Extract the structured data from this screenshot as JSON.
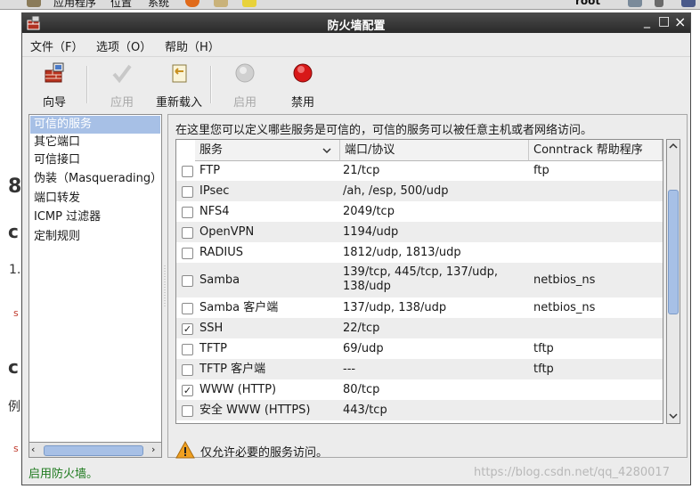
{
  "panel": {
    "menus": [
      "应用程序",
      "位置",
      "系统"
    ],
    "user": "root"
  },
  "background": {
    "fragments": [
      "8",
      "c",
      "1.",
      "s",
      "c",
      "例",
      "s"
    ]
  },
  "window": {
    "title": "防火墙配置",
    "controls": {
      "minimize": "_",
      "maximize": "□",
      "close": "×"
    },
    "menu": [
      "文件（F）",
      "选项（O）",
      "帮助（H）"
    ],
    "toolbar": [
      {
        "label": "向导",
        "enabled": true,
        "icon": "wizard-icon"
      },
      {
        "label": "应用",
        "enabled": false,
        "icon": "apply-check-icon"
      },
      {
        "label": "重新载入",
        "enabled": true,
        "icon": "reload-icon"
      },
      {
        "label": "启用",
        "enabled": false,
        "icon": "enable-grey-circle-icon"
      },
      {
        "label": "禁用",
        "enabled": true,
        "icon": "disable-red-circle-icon"
      }
    ],
    "sidebar": [
      {
        "label": "可信的服务",
        "selected": true
      },
      {
        "label": "其它端口",
        "selected": false
      },
      {
        "label": "可信接口",
        "selected": false
      },
      {
        "label": "伪装（Masquerading）",
        "selected": false
      },
      {
        "label": "端口转发",
        "selected": false
      },
      {
        "label": "ICMP 过滤器",
        "selected": false
      },
      {
        "label": "定制规则",
        "selected": false
      }
    ],
    "description": "在这里您可以定义哪些服务是可信的，可信的服务可以被任意主机或者网络访问。",
    "table": {
      "columns": [
        "服务",
        "端口/协议",
        "Conntrack 帮助程序"
      ],
      "rows": [
        {
          "service": "FTP",
          "ports": "21/tcp",
          "helper": "ftp",
          "checked": false
        },
        {
          "service": "IPsec",
          "ports": "/ah, /esp, 500/udp",
          "helper": "",
          "checked": false
        },
        {
          "service": "NFS4",
          "ports": "2049/tcp",
          "helper": "",
          "checked": false
        },
        {
          "service": "OpenVPN",
          "ports": "1194/udp",
          "helper": "",
          "checked": false
        },
        {
          "service": "RADIUS",
          "ports": "1812/udp, 1813/udp",
          "helper": "",
          "checked": false
        },
        {
          "service": "Samba",
          "ports": "139/tcp, 445/tcp, 137/udp,",
          "ports2": "138/udp",
          "helper": "netbios_ns",
          "checked": false
        },
        {
          "service": "Samba 客户端",
          "ports": "137/udp, 138/udp",
          "helper": "netbios_ns",
          "checked": false
        },
        {
          "service": "SSH",
          "ports": "22/tcp",
          "helper": "",
          "checked": true
        },
        {
          "service": "TFTP",
          "ports": "69/udp",
          "helper": "tftp",
          "checked": false
        },
        {
          "service": "TFTP 客户端",
          "ports": "---",
          "helper": "tftp",
          "checked": false
        },
        {
          "service": "WWW (HTTP)",
          "ports": "80/tcp",
          "helper": "",
          "checked": true
        },
        {
          "service": "安全 WWW (HTTPS)",
          "ports": "443/tcp",
          "helper": "",
          "checked": false
        }
      ]
    },
    "note": "仅允许必要的服务访问。",
    "status": "启用防火墙。"
  },
  "watermark": "https://blog.csdn.net/qq_4280017",
  "colors": {
    "selection": "#a7c0e6",
    "status_text": "#1e7a1e",
    "titlebar": "#2a2a2a"
  }
}
